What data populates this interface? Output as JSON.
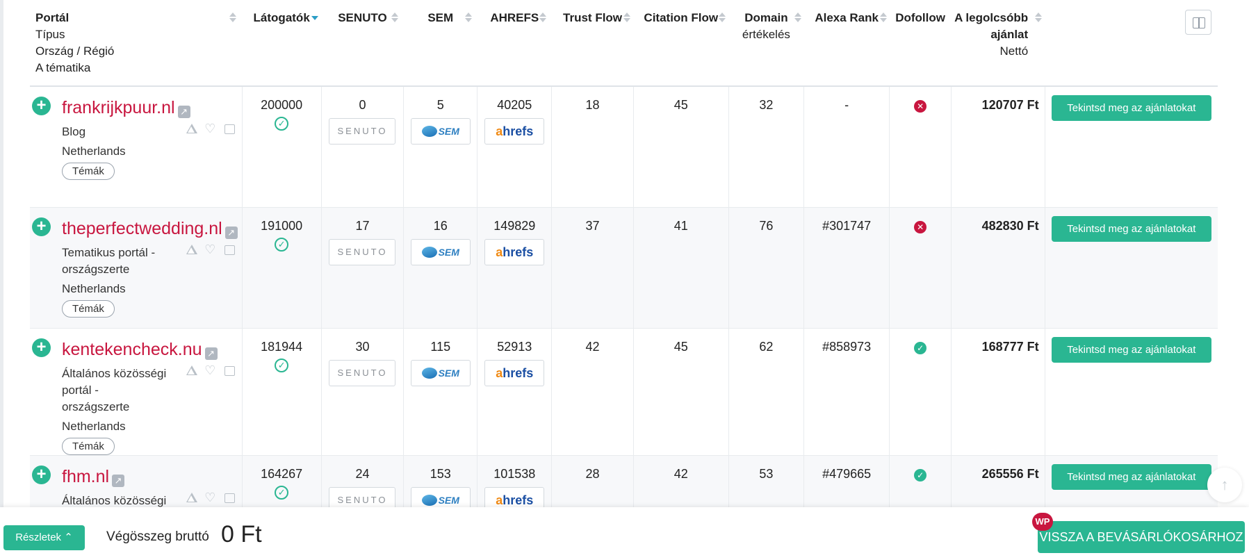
{
  "header": {
    "portal": "Portál",
    "portal_sub1": "Típus",
    "portal_sub2": "Ország / Régió",
    "portal_sub3": "A tématika",
    "visitors": "Látogatók",
    "senuto": "SENUTO",
    "sem": "SEM",
    "ahrefs": "AHREFS",
    "trust_flow": "Trust Flow",
    "citation_flow": "Citation Flow",
    "domain_rating_1": "Domain",
    "domain_rating_2": "értékelés",
    "alexa_rank": "Alexa Rank",
    "dofollow": "Dofollow",
    "price_1": "A legolcsóbb",
    "price_2": "ajánlat",
    "price_3": "Nettó"
  },
  "logos": {
    "senuto": "SENUTO",
    "sem": "SEM",
    "ahrefs_a": "a",
    "ahrefs_rest": "hrefs"
  },
  "rows": [
    {
      "site": "frankrijkpuur.nl",
      "type": "Blog",
      "country": "Netherlands",
      "topics": "Témák",
      "visitors": "200000",
      "senuto": "0",
      "sem": "5",
      "ahrefs": "40205",
      "tf": "18",
      "cf": "45",
      "dr": "32",
      "alexa": "-",
      "dofollow": false,
      "price": "120707 Ft",
      "button": "Tekintsd meg az ajánlatokat"
    },
    {
      "site": "theperfectwedding.nl",
      "type": "Tematikus portál - országszerte",
      "country": "Netherlands",
      "topics": "Témák",
      "visitors": "191000",
      "senuto": "17",
      "sem": "16",
      "ahrefs": "149829",
      "tf": "37",
      "cf": "41",
      "dr": "76",
      "alexa": "#301747",
      "dofollow": false,
      "price": "482830 Ft",
      "button": "Tekintsd meg az ajánlatokat"
    },
    {
      "site": "kentekencheck.nu",
      "type": "Általános közösségi portál - országszerte",
      "country": "Netherlands",
      "topics": "Témák",
      "visitors": "181944",
      "senuto": "30",
      "sem": "115",
      "ahrefs": "52913",
      "tf": "42",
      "cf": "45",
      "dr": "62",
      "alexa": "#858973",
      "dofollow": true,
      "price": "168777 Ft",
      "button": "Tekintsd meg az ajánlatokat"
    },
    {
      "site": "fhm.nl",
      "type": "Általános közösségi portál - országszerte",
      "country": "",
      "topics": "",
      "visitors": "164267",
      "senuto": "24",
      "sem": "153",
      "ahrefs": "101538",
      "tf": "28",
      "cf": "42",
      "dr": "53",
      "alexa": "#479665",
      "dofollow": true,
      "price": "265556 Ft",
      "button": "Tekintsd meg az ajánlatokat"
    }
  ],
  "footer": {
    "details": "Részletek",
    "total_label": "Végösszeg bruttó",
    "total_value": "0 Ft",
    "back_button": "VISSZA A BEVÁSÁRLÓKOSÁRHOZ",
    "badge": "WP"
  },
  "colors": {
    "accent": "#2ab692",
    "brand_red": "#c8163f",
    "sort_active": "#2c9ec6"
  }
}
